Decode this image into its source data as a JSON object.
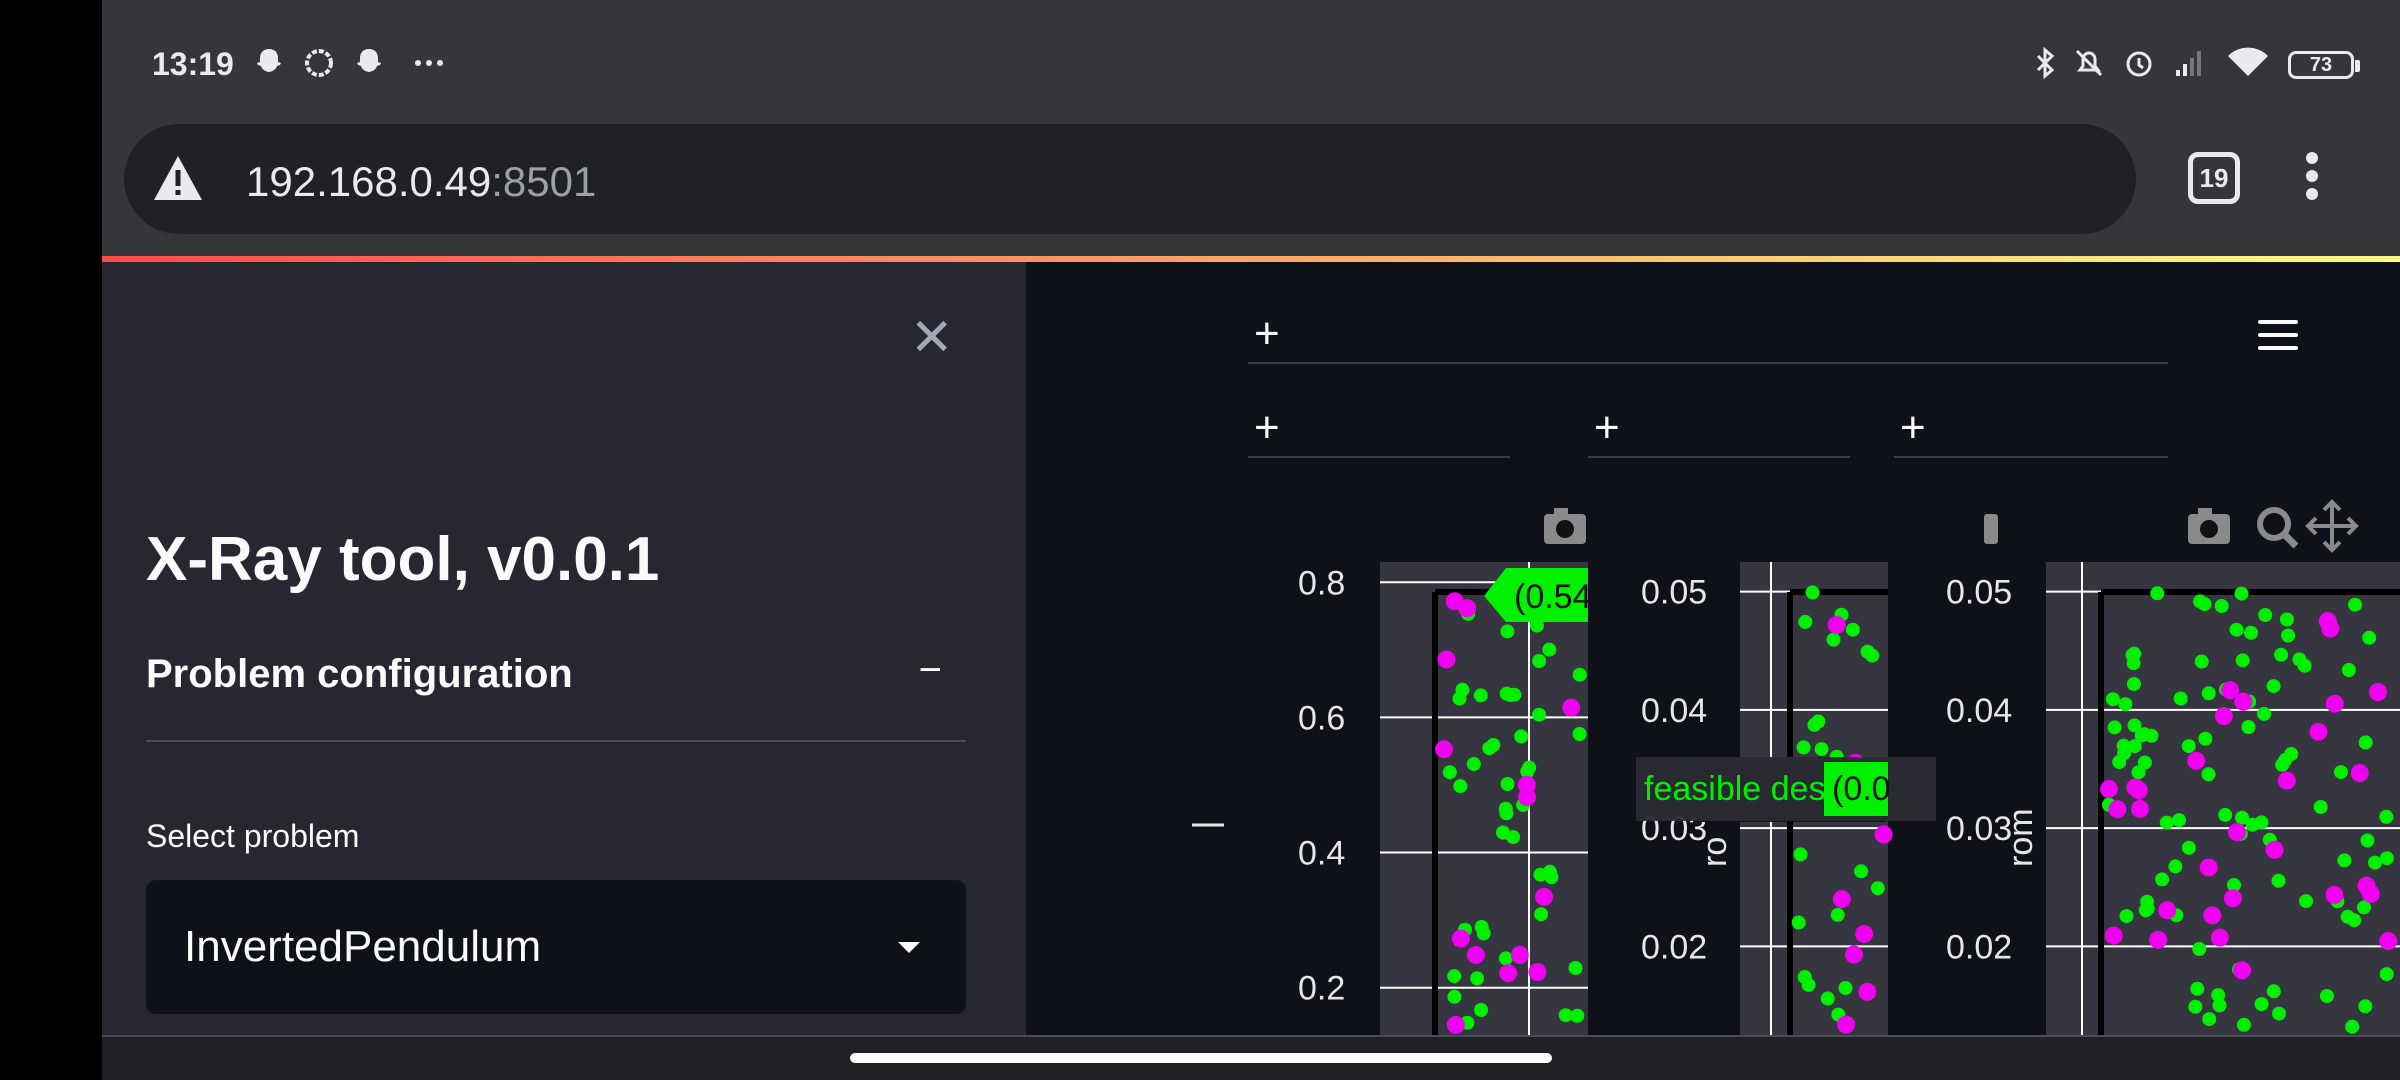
{
  "status_bar": {
    "time": "13:19",
    "notification_icons": [
      "snapchat-icon",
      "signal-icon",
      "snapchat-icon",
      "more-dots-icon"
    ],
    "right_icons": [
      "bluetooth-icon",
      "mute-icon",
      "alarm-icon",
      "cell-signal-icon",
      "wifi-icon"
    ],
    "battery": "73"
  },
  "browser": {
    "url_host": "192.168.0.49",
    "url_port": ":8501",
    "tab_count": "19"
  },
  "sidebar": {
    "close_symbol": "✕",
    "app_title": "X-Ray tool, v0.0.1",
    "section_title": "Problem configuration",
    "section_toggle": "−",
    "select_label": "Select problem",
    "select_value": "InvertedPendulum"
  },
  "main": {
    "expander_symbol": "+",
    "tooltips": {
      "left_label": "(0.54",
      "hover_name": "feasible des...",
      "hover_value": "(0.0"
    }
  },
  "colors": {
    "feasible": "#00f000",
    "infeasible": "#f000f0",
    "plot_bg": "#35363f",
    "accent_gradient": [
      "#ff4b4b",
      "#fffd80"
    ]
  },
  "chart_data": [
    {
      "type": "scatter",
      "title": "",
      "xlabel": "",
      "ylabel": "",
      "y_ticks": [
        "0.8",
        "0.6",
        "0.4",
        "0.2"
      ],
      "ylim": [
        0.13,
        0.83
      ],
      "series": [
        {
          "name": "",
          "color": "feasible",
          "count": 45
        },
        {
          "name": "",
          "color": "infeasible",
          "count": 14
        }
      ]
    },
    {
      "type": "scatter",
      "title": "",
      "xlabel": "",
      "ylabel": "ro",
      "y_ticks": [
        "0.05",
        "0.04",
        "0.03",
        "0.02"
      ],
      "ylim": [
        0.0125,
        0.0525
      ],
      "series": [
        {
          "name": "feasible des...",
          "color": "feasible",
          "count": 26
        },
        {
          "name": "",
          "color": "infeasible",
          "count": 10
        }
      ]
    },
    {
      "type": "scatter",
      "title": "",
      "xlabel": "",
      "ylabel": "rom",
      "y_ticks": [
        "0.05",
        "0.04",
        "0.03",
        "0.02"
      ],
      "ylim": [
        0.0125,
        0.0525
      ],
      "series": [
        {
          "name": "",
          "color": "feasible",
          "count": 95
        },
        {
          "name": "",
          "color": "infeasible",
          "count": 30
        }
      ]
    }
  ]
}
